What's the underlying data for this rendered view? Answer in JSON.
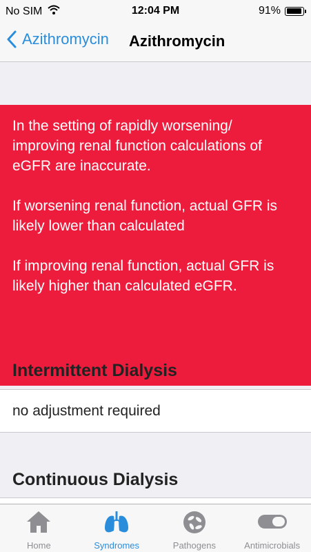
{
  "status_bar": {
    "carrier": "No SIM",
    "time": "12:04 PM",
    "battery": "91%",
    "battery_level": 0.91
  },
  "nav": {
    "back_label": "Azithromycin",
    "title": "Azithromycin"
  },
  "alert": {
    "paragraphs": [
      "In the setting of rapidly worsening/ improving renal function calculations of eGFR are inaccurate.",
      "If worsening renal function, actual GFR is likely lower than calculated",
      "If improving renal function, actual GFR is likely higher than calculated eGFR."
    ],
    "background": "#ee1c3c"
  },
  "sections": [
    {
      "title": "Intermittent Dialysis",
      "value": "no adjustment required"
    },
    {
      "title": "Continuous Dialysis"
    }
  ],
  "tabs": [
    {
      "label": "Home",
      "icon": "home-icon",
      "active": false
    },
    {
      "label": "Syndromes",
      "icon": "lungs-icon",
      "active": true
    },
    {
      "label": "Pathogens",
      "icon": "pathogen-icon",
      "active": false
    },
    {
      "label": "Antimicrobials",
      "icon": "pill-icon",
      "active": false
    }
  ],
  "colors": {
    "accent": "#2a8ddc",
    "alert": "#ee1c3c",
    "inactive_tab": "#8e8e93"
  }
}
